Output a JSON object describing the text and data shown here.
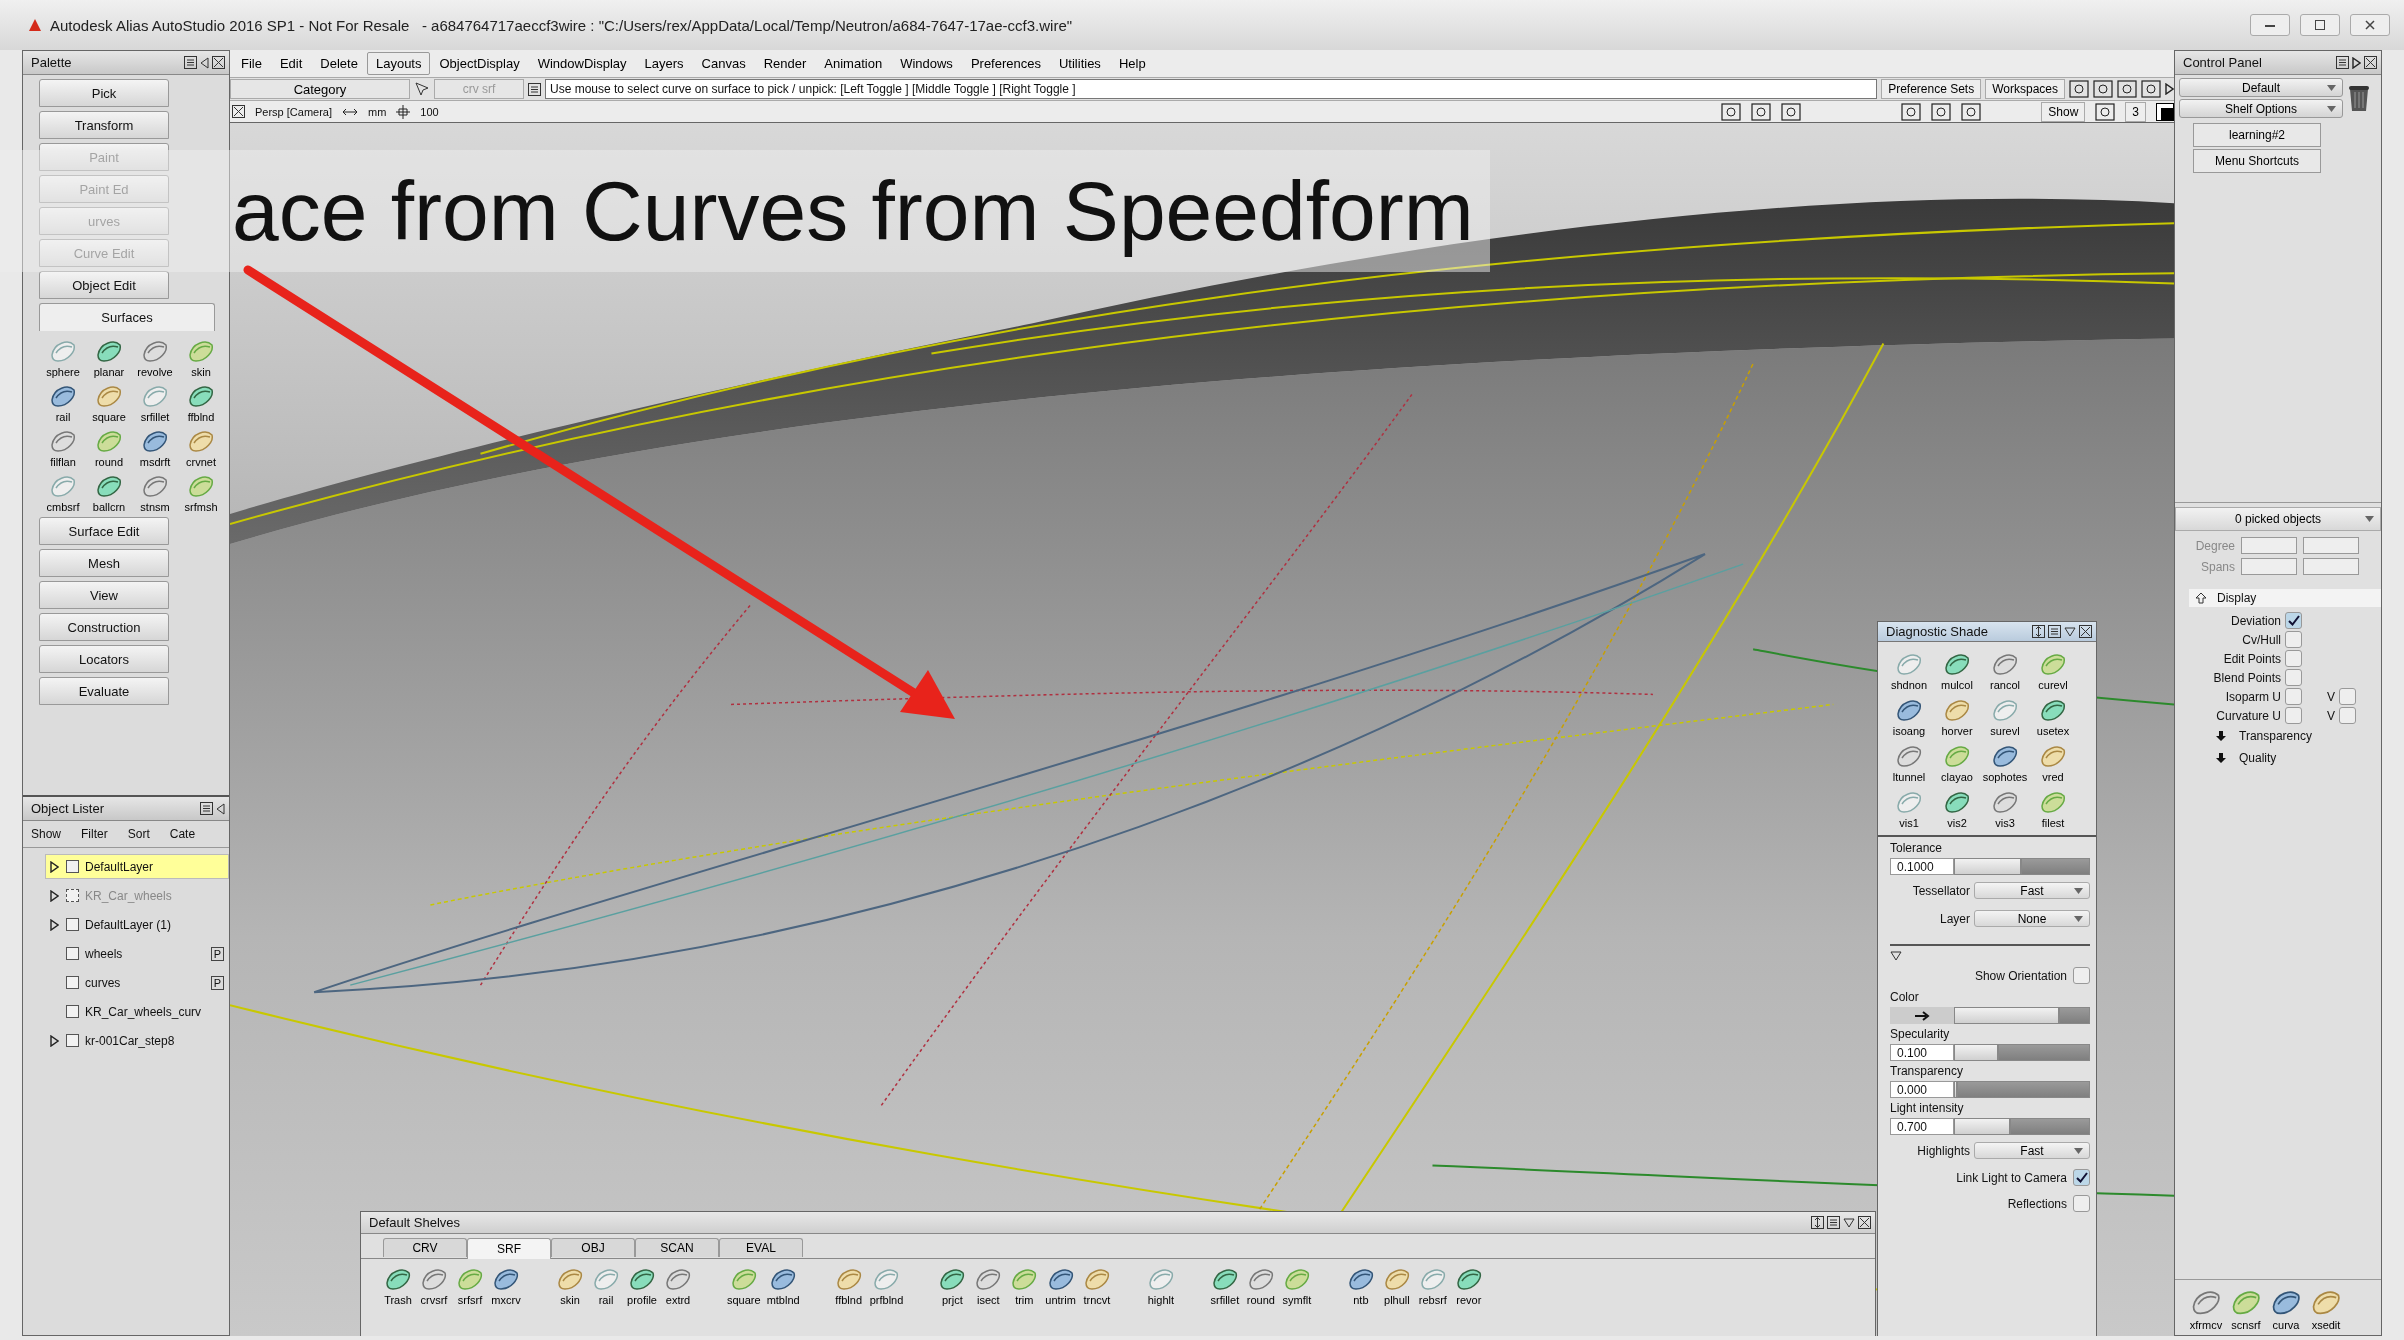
{
  "window": {
    "title": "Autodesk Alias AutoStudio 2016 SP1 - Not For Resale   - a684764717aeccf3wire : \"C:/Users/rex/AppData/Local/Temp/Neutron/a684-7647-17ae-ccf3.wire\""
  },
  "overlay_title": "ace from Curves from Speedform",
  "palette": {
    "title": "Palette",
    "sections": [
      {
        "label": "Pick",
        "disabled": false,
        "expanded": false
      },
      {
        "label": "Transform",
        "disabled": false,
        "expanded": false
      },
      {
        "label": "Paint",
        "disabled": true,
        "expanded": false
      },
      {
        "label": "Paint Ed",
        "disabled": true,
        "expanded": false
      },
      {
        "label": "urves",
        "disabled": true,
        "expanded": false
      },
      {
        "label": "Curve Edit",
        "disabled": true,
        "expanded": false
      },
      {
        "label": "Object Edit",
        "disabled": false,
        "expanded": false
      },
      {
        "label": "Surfaces",
        "disabled": false,
        "expanded": true,
        "tools": [
          "sphere",
          "planar",
          "revolve",
          "skin",
          "rail",
          "square",
          "srfillet",
          "ffblnd",
          "filflan",
          "round",
          "msdrft",
          "crvnet",
          "cmbsrf",
          "ballcrn",
          "stnsm",
          "srfmsh"
        ]
      },
      {
        "label": "Surface Edit",
        "disabled": false,
        "expanded": false
      },
      {
        "label": "Mesh",
        "disabled": false,
        "expanded": false
      },
      {
        "label": "View",
        "disabled": false,
        "expanded": false
      },
      {
        "label": "Construction",
        "disabled": false,
        "expanded": false
      },
      {
        "label": "Locators",
        "disabled": false,
        "expanded": false
      },
      {
        "label": "Evaluate",
        "disabled": false,
        "expanded": false
      }
    ]
  },
  "object_lister": {
    "title": "Object Lister",
    "menu": [
      "Show",
      "Filter",
      "Sort",
      "Cate"
    ],
    "items": [
      {
        "label": "DefaultLayer",
        "expandable": true,
        "selected": true,
        "dimmed": false
      },
      {
        "label": "KR_Car_wheels",
        "expandable": true,
        "selected": false,
        "dimmed": true
      },
      {
        "label": "DefaultLayer (1)",
        "expandable": true,
        "selected": false,
        "dimmed": false
      },
      {
        "label": "wheels",
        "expandable": false,
        "selected": false,
        "dimmed": false,
        "pick_tag": "P"
      },
      {
        "label": "curves",
        "expandable": false,
        "selected": false,
        "dimmed": false,
        "pick_tag": "P"
      },
      {
        "label": "KR_Car_wheels_curv",
        "expandable": false,
        "selected": false,
        "dimmed": false
      },
      {
        "label": "kr-001Car_step8",
        "expandable": true,
        "selected": false,
        "dimmed": false
      }
    ]
  },
  "menu": [
    {
      "label": "File",
      "selected": false
    },
    {
      "label": "Edit",
      "selected": false
    },
    {
      "label": "Delete",
      "selected": false
    },
    {
      "label": "Layouts",
      "selected": true
    },
    {
      "label": "ObjectDisplay",
      "selected": false
    },
    {
      "label": "WindowDisplay",
      "selected": false
    },
    {
      "label": "Layers",
      "selected": false
    },
    {
      "label": "Canvas",
      "selected": false
    },
    {
      "label": "Render",
      "selected": false
    },
    {
      "label": "Animation",
      "selected": false
    },
    {
      "label": "Windows",
      "selected": false
    },
    {
      "label": "Preferences",
      "selected": false
    },
    {
      "label": "Utilities",
      "selected": false
    },
    {
      "label": "Help",
      "selected": false
    }
  ],
  "toolbar": {
    "category": "Category",
    "pick_mode": "crv srf",
    "prompt": "Use mouse to select curve on surface to pick / unpick: [Left Toggle ] [Middle Toggle ] [Right Toggle ]",
    "preference_sets": "Preference Sets",
    "workspaces": "Workspaces"
  },
  "view_bar": {
    "camera": "Persp [Camera]",
    "units": "mm",
    "grid": "100",
    "show": "Show",
    "count": "3"
  },
  "control_panel": {
    "title": "Control Panel",
    "preset": "Default",
    "shelf_options": "Shelf Options",
    "tab": "learning#2",
    "menu_shortcuts": "Menu Shortcuts",
    "picked": "0 picked objects",
    "degree": "Degree",
    "spans": "Spans",
    "display": {
      "title": "Display",
      "options": [
        {
          "label": "Deviation",
          "checked": true
        },
        {
          "label": "Cv/Hull",
          "checked": false
        },
        {
          "label": "Edit Points",
          "checked": false
        },
        {
          "label": "Blend Points",
          "checked": false
        },
        {
          "label": "Isoparm U",
          "checked": false,
          "v_label": "V",
          "v_checked": false
        },
        {
          "label": "Curvature U",
          "checked": false,
          "v_label": "V",
          "v_checked": false
        }
      ],
      "expanders": [
        "Transparency",
        "Quality"
      ]
    },
    "tools": [
      "xfrmcv",
      "scnsrf",
      "curva",
      "xsedit"
    ]
  },
  "diagnostic": {
    "title": "Diagnostic Shade",
    "modes": [
      "shdnon",
      "mulcol",
      "rancol",
      "curevl",
      "isoang",
      "horver",
      "surevl",
      "usetex",
      "ltunnel",
      "clayao",
      "sophotes",
      "vred",
      "vis1",
      "vis2",
      "vis3",
      "filest"
    ],
    "tolerance": {
      "label": "Tolerance",
      "value": "0.1000",
      "level": 0.5
    },
    "tessellator": {
      "label": "Tessellator",
      "value": "Fast"
    },
    "layer": {
      "label": "Layer",
      "value": "None"
    },
    "show_orientation": {
      "label": "Show Orientation",
      "checked": false
    },
    "color": {
      "label": "Color",
      "level": 0.78
    },
    "specularity": {
      "label": "Specularity",
      "value": "0.100",
      "level": 0.33
    },
    "transparency": {
      "label": "Transparency",
      "value": "0.000",
      "level": 0.02
    },
    "light_intensity": {
      "label": "Light intensity",
      "value": "0.700",
      "level": 0.42
    },
    "highlights": {
      "label": "Highlights",
      "value": "Fast"
    },
    "link_light": {
      "label": "Link Light to Camera",
      "checked": true
    },
    "reflections": {
      "label": "Reflections",
      "checked": false
    }
  },
  "shelves": {
    "title": "Default Shelves",
    "tabs": [
      {
        "label": "CRV",
        "selected": false
      },
      {
        "label": "SRF",
        "selected": true
      },
      {
        "label": "OBJ",
        "selected": false
      },
      {
        "label": "SCAN",
        "selected": false
      },
      {
        "label": "EVAL",
        "selected": false
      }
    ],
    "tool_groups": [
      [
        "Trash",
        "crvsrf",
        "srfsrf",
        "mxcrv"
      ],
      [
        "skin",
        "rail",
        "profile",
        "extrd"
      ],
      [
        "square",
        "mtblnd"
      ],
      [
        "ffblnd",
        "prfblnd"
      ],
      [
        "prjct",
        "isect",
        "trim",
        "untrim",
        "trncvt"
      ],
      [
        "highlt"
      ],
      [
        "srfillet",
        "round",
        "symflt"
      ],
      [
        "ntb",
        "plhull",
        "rebsrf",
        "revor"
      ]
    ]
  }
}
